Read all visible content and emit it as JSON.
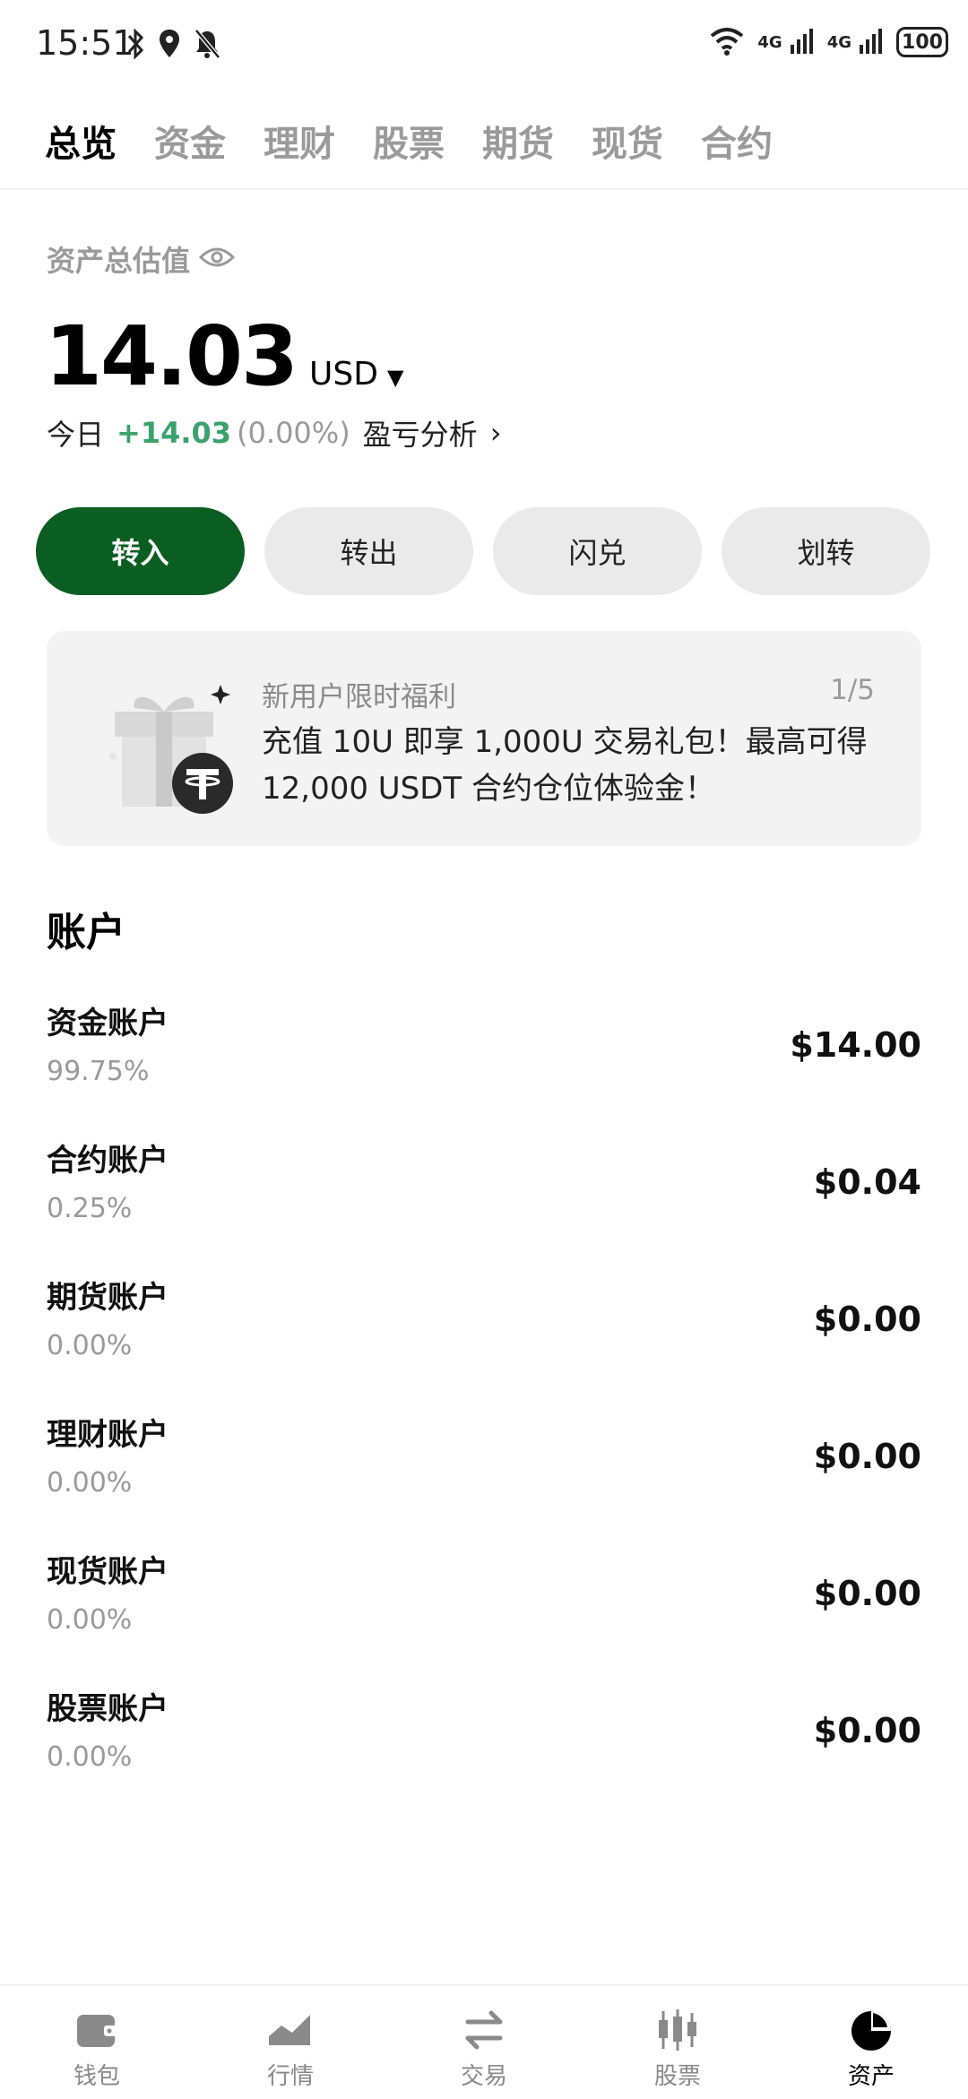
{
  "status_bar": {
    "time": "15:51",
    "network_1": "4G",
    "network_2": "4G",
    "battery": "100"
  },
  "tabs": [
    {
      "label": "总览",
      "active": true
    },
    {
      "label": "资金",
      "active": false
    },
    {
      "label": "理财",
      "active": false
    },
    {
      "label": "股票",
      "active": false
    },
    {
      "label": "期货",
      "active": false
    },
    {
      "label": "现货",
      "active": false
    },
    {
      "label": "合约",
      "active": false
    }
  ],
  "summary": {
    "label": "资产总估值",
    "balance": "14.03",
    "currency": "USD",
    "today_label": "今日",
    "today_change": "+14.03",
    "today_pct": "(0.00%)",
    "pnl_link": "盈亏分析"
  },
  "actions": [
    {
      "label": "转入",
      "primary": true
    },
    {
      "label": "转出",
      "primary": false
    },
    {
      "label": "闪兑",
      "primary": false
    },
    {
      "label": "划转",
      "primary": false
    }
  ],
  "promo": {
    "title": "新用户限时福利",
    "page": "1/5",
    "body": "充值 10U 即享 1,000U 交易礼包！最高可得 12,000 USDT 合约仓位体验金！"
  },
  "accounts": {
    "title": "账户",
    "items": [
      {
        "name": "资金账户",
        "pct": "99.75%",
        "amount": "$14.00"
      },
      {
        "name": "合约账户",
        "pct": "0.25%",
        "amount": "$0.04"
      },
      {
        "name": "期货账户",
        "pct": "0.00%",
        "amount": "$0.00"
      },
      {
        "name": "理财账户",
        "pct": "0.00%",
        "amount": "$0.00"
      },
      {
        "name": "现货账户",
        "pct": "0.00%",
        "amount": "$0.00"
      },
      {
        "name": "股票账户",
        "pct": "0.00%",
        "amount": "$0.00"
      }
    ]
  },
  "bottom_nav": [
    {
      "label": "钱包",
      "icon": "wallet-icon",
      "active": false
    },
    {
      "label": "行情",
      "icon": "market-chart-icon",
      "active": false
    },
    {
      "label": "交易",
      "icon": "swap-arrows-icon",
      "active": false
    },
    {
      "label": "股票",
      "icon": "candlestick-icon",
      "active": false
    },
    {
      "label": "资产",
      "icon": "pie-chart-icon",
      "active": true
    }
  ],
  "colors": {
    "primary_green": "#0b5e22",
    "positive_green": "#3aa36c"
  }
}
